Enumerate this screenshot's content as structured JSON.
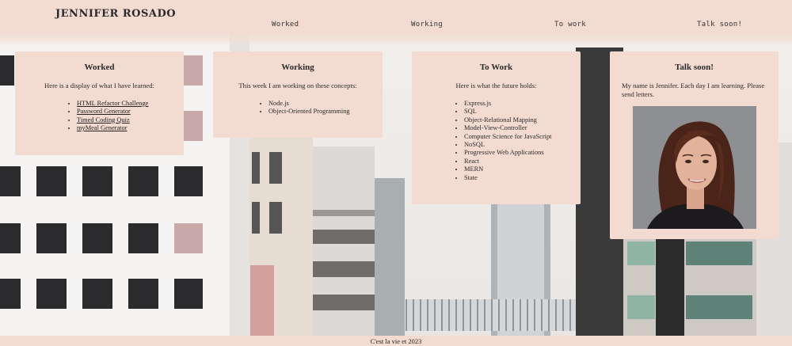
{
  "header": {
    "brand": "JENNIFER ROSADO",
    "nav": [
      "Worked",
      "Working",
      "To work",
      "Talk soon!"
    ]
  },
  "cards": {
    "worked": {
      "title": "Worked",
      "intro": "Here is a display of what I have learned:",
      "items": [
        "HTML Refactor Challenge",
        "Password Generator",
        "Timed Coding Quiz",
        "myMeal Generator"
      ]
    },
    "working": {
      "title": "Working",
      "intro": "This week I am working on these concepts:",
      "items": [
        "Node.js",
        "Object-Oriented Programming"
      ]
    },
    "towork": {
      "title": "To Work",
      "intro": "Here is what the future holds:",
      "items": [
        "Express.js",
        "SQL",
        "Object-Relational Mapping",
        "Model-View-Controller",
        "Computer Science for JavaScript",
        "NoSQL",
        "Progressive Web Applications",
        "React",
        "MERN",
        "State"
      ]
    },
    "talk": {
      "title": "Talk soon!",
      "intro": "My name is Jennifer. Each day I am learning. Please send letters."
    }
  },
  "footer": {
    "text": "C'est la vie et 2023"
  },
  "colors": {
    "card_bg": "#f3dbd1",
    "text": "#2a2a2a"
  }
}
